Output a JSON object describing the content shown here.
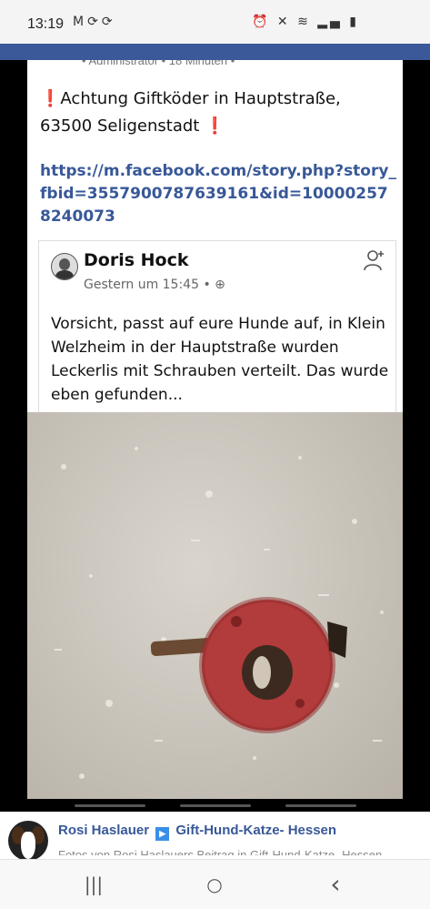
{
  "status_bar": {
    "time": "13:19",
    "left_icons": [
      "gmail-icon",
      "sync-icon",
      "sync-icon"
    ],
    "right_icons": [
      "alarm-icon",
      "mute-icon",
      "wifi-icon",
      "signal-icon",
      "battery-icon"
    ]
  },
  "post": {
    "meta": "• Administrator • 18 Minuten •",
    "text_line1": "Achtung Giftköder in Hauptstraße,",
    "text_line2": "63500 Seligenstadt",
    "excl_mark": "❗",
    "link": "https://m.facebook.com/story.php?story_fbid=3557900787639161&id=100002578240073",
    "shared": {
      "author": "Doris Hock",
      "time": "Gestern um 15:45 •",
      "text": "Vorsicht, passt auf eure Hunde auf, in Klein Welzheim in der Hauptstraße wurden Leckerlis mit Schrauben verteilt. Das wurde eben gefunden..."
    }
  },
  "bottom_post": {
    "author": "Rosi Haslauer",
    "group": "Gift-Hund-Katze- Hessen",
    "sub": "Fotos von Rosi Haslauers Beitrag in Gift-Hund-Katze- Hessen"
  },
  "nav": {
    "recents": "|||",
    "home": "○",
    "back": "‹"
  }
}
